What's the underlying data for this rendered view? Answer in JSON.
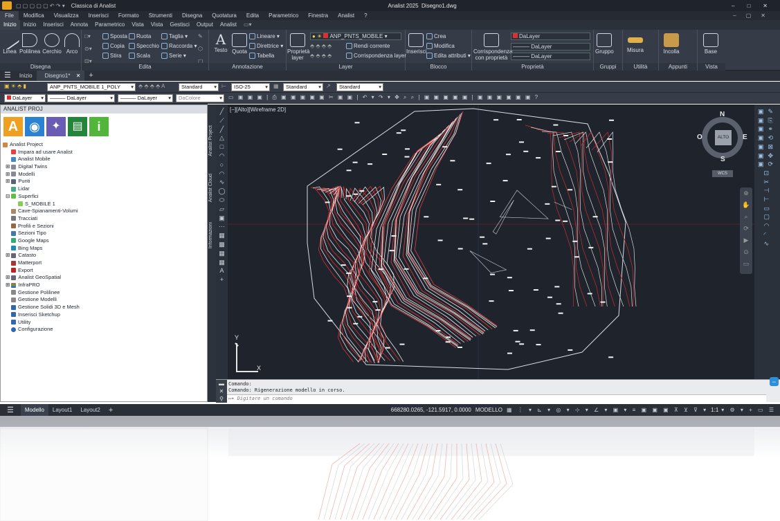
{
  "app": {
    "title": "Analist 2025",
    "document": "Disegno1.dwg",
    "workspace": "Classica di Analist"
  },
  "menu": [
    "File",
    "Modifica",
    "Visualizza",
    "Inserisci",
    "Formato",
    "Strumenti",
    "Disegna",
    "Quotatura",
    "Edita",
    "Parametrico",
    "Finestra",
    "Analist",
    "?"
  ],
  "ribbon_tabs": [
    "Inizio",
    "Inizio",
    "Inserisci",
    "Annota",
    "Parametrico",
    "Vista",
    "Vista",
    "Gestisci",
    "Output",
    "Analist"
  ],
  "ribbon": {
    "disegna": {
      "title": "Disegna",
      "linea": "Linea",
      "polilinea": "Polilinea",
      "cerchio": "Cerchio",
      "arco": "Arco"
    },
    "edita": {
      "title": "Edita",
      "sposta": "Sposta",
      "copia": "Copia",
      "stira": "Stira",
      "ruota": "Ruota",
      "specchio": "Specchio",
      "scala": "Scala",
      "taglia": "Taglia",
      "raccorda": "Raccorda",
      "serie": "Serie"
    },
    "annotazione": {
      "title": "Annotazione",
      "testo": "Testo",
      "quota": "Quota",
      "lineare": "Lineare",
      "direttrice": "Direttrice",
      "tabella": "Tabella"
    },
    "layer": {
      "title": "Layer",
      "proprieta_layer": "Proprietà layer",
      "current": "ANP_PNTS_MOBILE",
      "rendi_corrente": "Rendi corrente",
      "corrispondenza_layer": "Corrispondenza layer"
    },
    "blocco": {
      "title": "Blocco",
      "inserisci": "Inserisci",
      "crea": "Crea",
      "modifica": "Modifica",
      "edita_attributi": "Edita attributi"
    },
    "proprieta": {
      "title": "Proprietà",
      "corrispondenza": "Corrispondenza con proprietà",
      "color": "DaLayer",
      "linetype": "DaLayer",
      "lineweight": "DaLayer"
    },
    "gruppi": {
      "title": "Gruppi",
      "gruppo": "Gruppo"
    },
    "utilita": {
      "title": "Utilità",
      "misura": "Misura"
    },
    "appunti": {
      "title": "Appunti",
      "incolla": "Incolla"
    },
    "vista": {
      "title": "Vista",
      "base": "Base"
    }
  },
  "doc_tabs": [
    "Inizio",
    "Disegno1*"
  ],
  "toolbar1": {
    "layer": "ANP_PNTS_MOBILE 1_POLY",
    "text_style": "Standard",
    "dim_style": "ISO-25",
    "table_style": "Standard",
    "mleader_style": "Standard"
  },
  "toolbar2": {
    "color": "DaLayer",
    "linetype": "DaLayer",
    "lineweight": "DaLayer",
    "plotstyle": "DaColore"
  },
  "panel": {
    "title": "ANALIST PROJ",
    "side_tabs": [
      "Analist Project",
      "Analist Cloud",
      "Informazioni"
    ],
    "tree": [
      "Analist Project",
      "Impara ad usare Analist",
      "Analist Mobile",
      "Digital Twins",
      "Modelli",
      "Punti",
      "Lidar",
      "Superfici",
      "S_MOBILE 1",
      "Cave-Spianamenti-Volumi",
      "Tracciati",
      "Profili e Sezioni",
      "Sezioni Tipo",
      "Google Maps",
      "Bing Maps",
      "Catasto",
      "Matterport",
      "Export",
      "Analist GeoSpatial",
      "InfraPRO",
      "Gestione Polilinee",
      "Gestione Modelli",
      "Gestione Solidi 3D e Mesh",
      "Inserisci Sketchup",
      "Utility",
      "Configurazione"
    ]
  },
  "viewport": {
    "label": "[−][Alto][Wireframe 2D]",
    "compass": {
      "n": "N",
      "s": "S",
      "e": "E",
      "o": "O",
      "center": "ALTO"
    },
    "ucs": "WCS",
    "axis_x": "X",
    "axis_y": "Y"
  },
  "command": {
    "line1": "Comando:",
    "line2": "Comando: Rigenerazione modello in corso.",
    "placeholder": "Digitare un comando"
  },
  "status": {
    "tabs": [
      "Modello",
      "Layout1",
      "Layout2"
    ],
    "coords": "668280.0265, -121.5917, 0.0000",
    "mode": "MODELLO",
    "scale": "1:1"
  },
  "colors": {
    "accent": "#d93030",
    "canvas": "#1e232c",
    "ribbon": "#353c47"
  }
}
